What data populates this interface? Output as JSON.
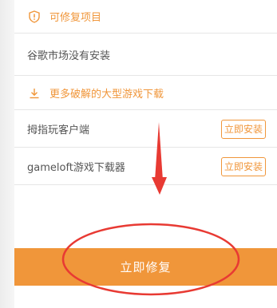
{
  "list": {
    "repairable_header": "可修复项目",
    "repairable_item": "谷歌市场没有安装",
    "download_header": "更多破解的大型游戏下载",
    "apps": [
      {
        "name": "拇指玩客户端",
        "button": "立即安装"
      },
      {
        "name": "gameloft游戏下载器",
        "button": "立即安装"
      }
    ]
  },
  "footer": {
    "repair_button": "立即修复"
  },
  "colors": {
    "accent": "#f0963a",
    "annotation": "#e83a33"
  },
  "annotations": {
    "arrow": "red-arrow-pointing-down",
    "ellipse": "red-ellipse-around-repair-button"
  }
}
